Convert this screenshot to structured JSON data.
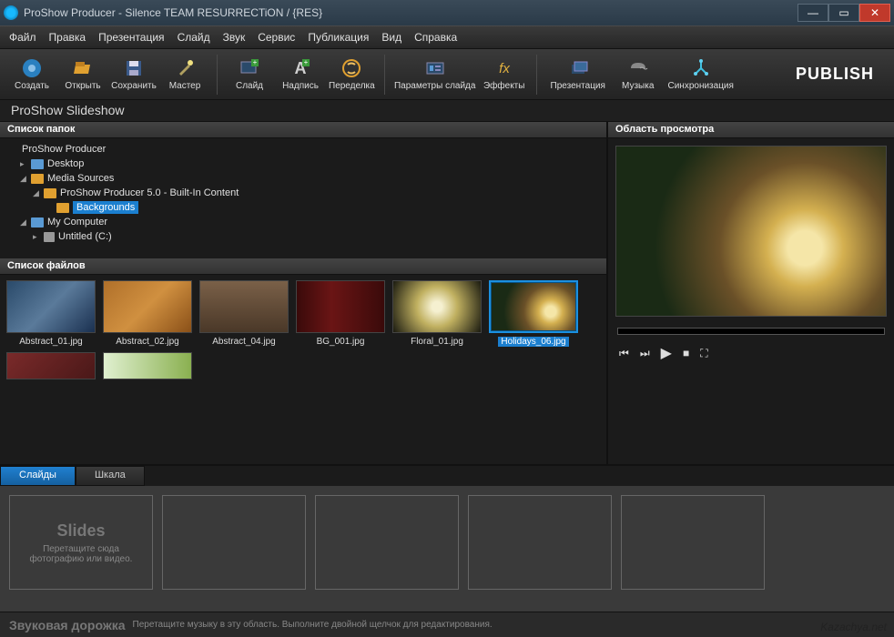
{
  "window": {
    "title": "ProShow Producer - Silence TEAM RESURRECTiON / {RES}"
  },
  "menu": [
    "Файл",
    "Правка",
    "Презентация",
    "Слайд",
    "Звук",
    "Сервис",
    "Публикация",
    "Вид",
    "Справка"
  ],
  "toolbar": {
    "create": "Создать",
    "open": "Открыть",
    "save": "Сохранить",
    "master": "Мастер",
    "slide": "Слайд",
    "caption": "Надпись",
    "remix": "Переделка",
    "slideopts": "Параметры слайда",
    "effects": "Эффекты",
    "presentation": "Презентация",
    "music": "Музыка",
    "sync": "Синхронизация",
    "publish": "PUBLISH"
  },
  "slideshow_title": "ProShow Slideshow",
  "panes": {
    "folders": "Список папок",
    "files": "Список файлов",
    "preview": "Область просмотра"
  },
  "tree": {
    "root": "ProShow Producer",
    "desktop": "Desktop",
    "media": "Media Sources",
    "builtin": "ProShow Producer 5.0 - Built-In Content",
    "backgrounds": "Backgrounds",
    "mycomputer": "My Computer",
    "driveC": "Untitled (C:)"
  },
  "files": [
    {
      "name": "Abstract_01.jpg",
      "cls": "bg-abs1"
    },
    {
      "name": "Abstract_02.jpg",
      "cls": "bg-abs2"
    },
    {
      "name": "Abstract_04.jpg",
      "cls": "bg-abs4"
    },
    {
      "name": "BG_001.jpg",
      "cls": "bg-bg001"
    },
    {
      "name": "Floral_01.jpg",
      "cls": "bg-floral"
    },
    {
      "name": "Holidays_06.jpg",
      "cls": "canvas-holiday",
      "selected": true
    }
  ],
  "tabs": {
    "slides": "Слайды",
    "timeline": "Шкала"
  },
  "slides_hint": {
    "title": "Slides",
    "line1": "Перетащите сюда",
    "line2": "фотографию или видео."
  },
  "audio": {
    "title": "Звуковая дорожка",
    "hint": "Перетащите музыку в эту область. Выполните двойной щелчок для редактирования."
  },
  "watermark": "Kazachya.net"
}
